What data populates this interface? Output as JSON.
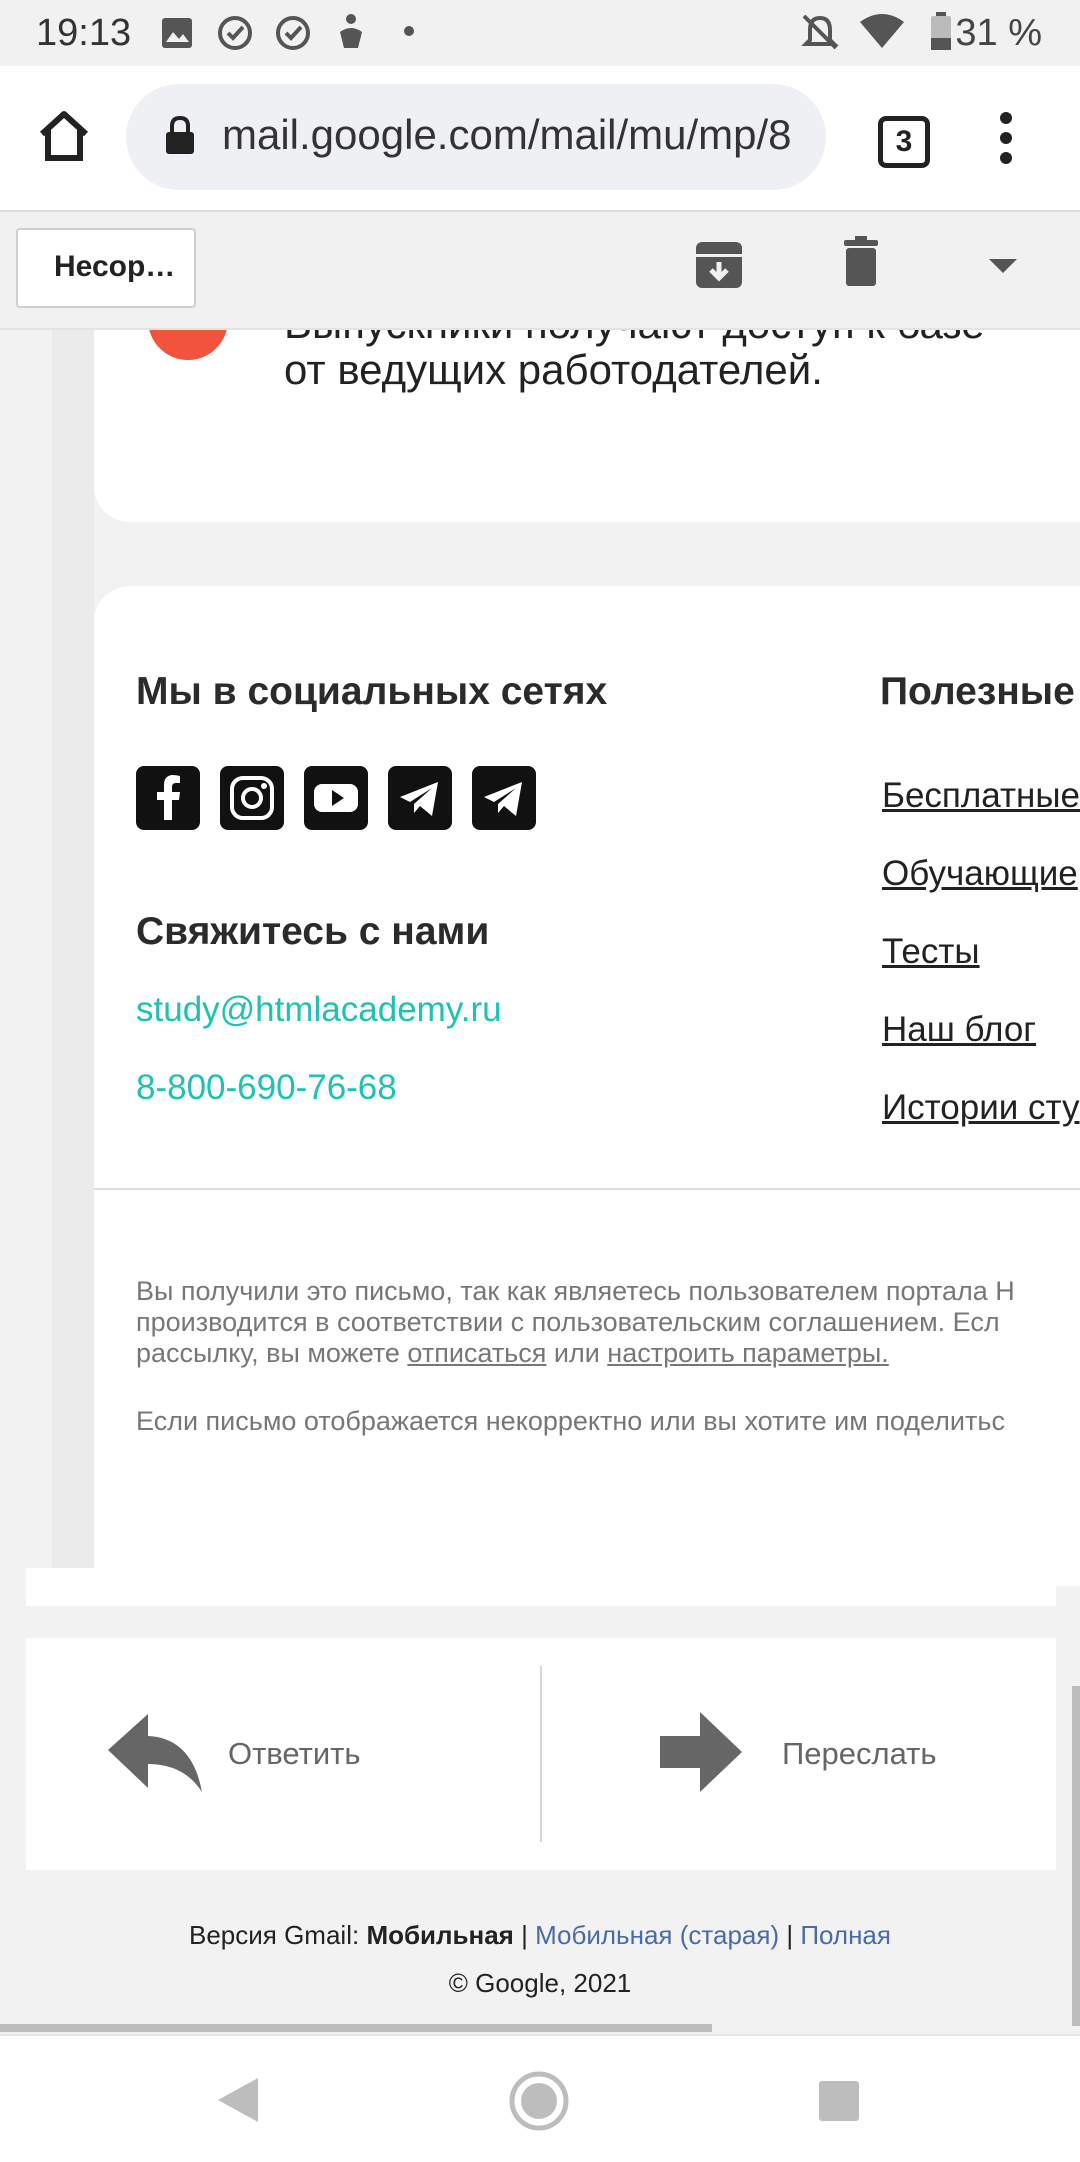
{
  "status_bar": {
    "time": "19:13",
    "battery": "31 %",
    "icons": [
      "image-icon",
      "check-circle-icon",
      "check-circle-icon",
      "accessibility-icon",
      "dot-icon",
      "do-not-disturb-icon",
      "wifi-icon",
      "battery-icon"
    ]
  },
  "browser": {
    "url": "mail.google.com/mail/mu/mp/8",
    "tab_count": "3"
  },
  "gmail_header": {
    "back_label": "Несор…"
  },
  "email": {
    "partial_line1": "Выпускники получают доступ к базе",
    "partial_line2": "от ведущих работодателей.",
    "social_heading": "Мы в социальных сетях",
    "useful_heading": "Полезные",
    "contact_heading": "Свяжитесь с нами",
    "email": "study@htmlacademy.ru",
    "phone": "8-800-690-76-68",
    "links": [
      "Бесплатные",
      "Обучающие",
      "Тесты",
      "Наш блог",
      "Истории сту"
    ],
    "fine_print_line1": "Вы получили это письмо, так как являетесь пользователем портала H",
    "fine_print_line2": "производится в соответствии с пользовательским соглашением. Есл",
    "fine_print_line3_pre": "рассылку, вы можете ",
    "unsubscribe": "отписаться",
    "fine_print_or": " или ",
    "settings": "настроить параметры.",
    "fine_print_2": "Если письмо отображается некорректно или вы хотите им поделитьс"
  },
  "actions": {
    "reply": "Ответить",
    "forward": "Переслать"
  },
  "footer": {
    "version_prefix": "Версия Gmail: ",
    "version_current": "Мобильная",
    "sep": " | ",
    "version_old": "Мобильная (старая)",
    "version_full": "Полная",
    "copyright": "© Google, 2021"
  }
}
